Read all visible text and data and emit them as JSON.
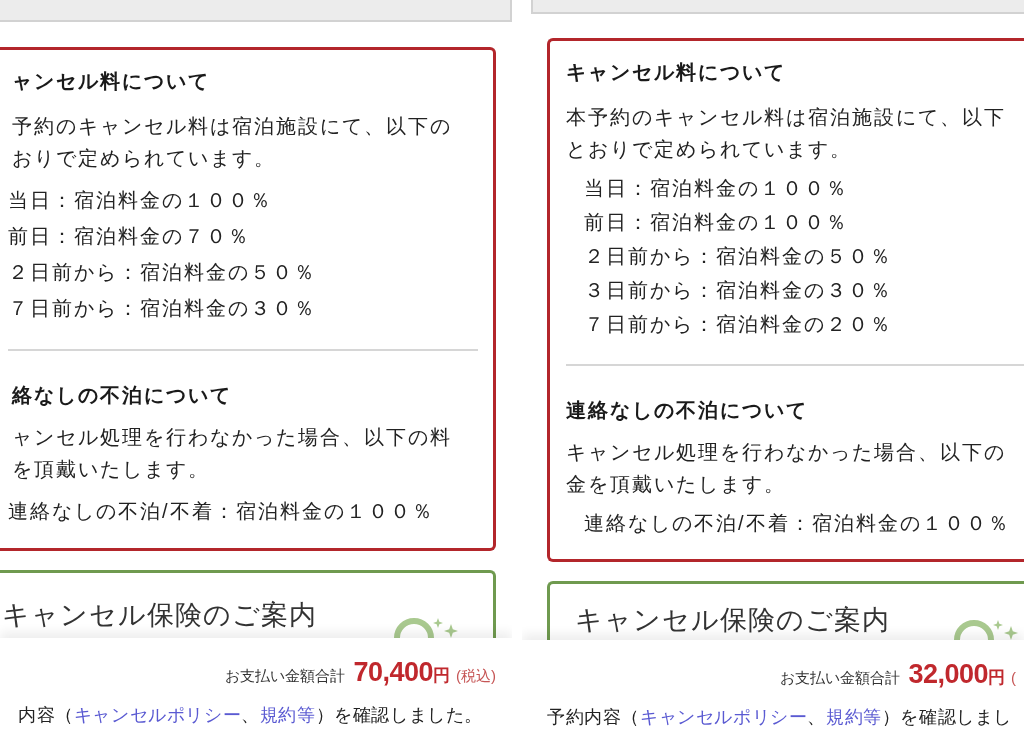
{
  "screens": [
    {
      "fee_policy": {
        "title": "ャンセル料について",
        "paragraph": [
          "予約のキャンセル料は宿泊施設にて、以下の",
          "おりで定められています。"
        ],
        "items": [
          "当日：宿泊料金の１００％",
          "前日：宿泊料金の７０％",
          "２日前から：宿泊料金の５０％",
          "７日前から：宿泊料金の３０％"
        ]
      },
      "no_show_policy": {
        "title": "絡なしの不泊について",
        "paragraph": [
          "ャンセル処理を行わなかった場合、以下の料",
          "を頂戴いたします。"
        ],
        "items": [
          "連絡なしの不泊/不着：宿泊料金の１００％"
        ]
      },
      "insurance_banner": {
        "title": "キャンセル保険のご案内"
      },
      "payment": {
        "label": "お支払い金額合計",
        "amount": "70,400",
        "unit": "円",
        "tax_note": "(税込)"
      },
      "confirmation": [
        {
          "kind": "text",
          "text": "内容（"
        },
        {
          "kind": "link",
          "text": "キャンセルポリシー"
        },
        {
          "kind": "text",
          "text": "、"
        },
        {
          "kind": "link",
          "text": "規約等"
        },
        {
          "kind": "text",
          "text": "）を確認しました。"
        }
      ]
    },
    {
      "fee_policy": {
        "title": "キャンセル料について",
        "paragraph": [
          "本予約のキャンセル料は宿泊施設にて、以下",
          "とおりで定められています。"
        ],
        "items": [
          "当日：宿泊料金の１００％",
          "前日：宿泊料金の１００％",
          "２日前から：宿泊料金の５０％",
          "３日前から：宿泊料金の３０％",
          "７日前から：宿泊料金の２０％"
        ]
      },
      "no_show_policy": {
        "title": "連絡なしの不泊について",
        "paragraph": [
          "キャンセル処理を行わなかった場合、以下の",
          "金を頂戴いたします。"
        ],
        "items": [
          "連絡なしの不泊/不着：宿泊料金の１００％"
        ]
      },
      "insurance_banner": {
        "title": "キャンセル保険のご案内"
      },
      "payment": {
        "label": "お支払い金額合計",
        "amount": "32,000",
        "unit": "円",
        "tax_note": "("
      },
      "confirmation": [
        {
          "kind": "text",
          "text": "予約内容（"
        },
        {
          "kind": "link",
          "text": "キャンセルポリシー"
        },
        {
          "kind": "text",
          "text": "、"
        },
        {
          "kind": "link",
          "text": "規約等"
        },
        {
          "kind": "text",
          "text": "）を確認しまし"
        }
      ]
    }
  ]
}
